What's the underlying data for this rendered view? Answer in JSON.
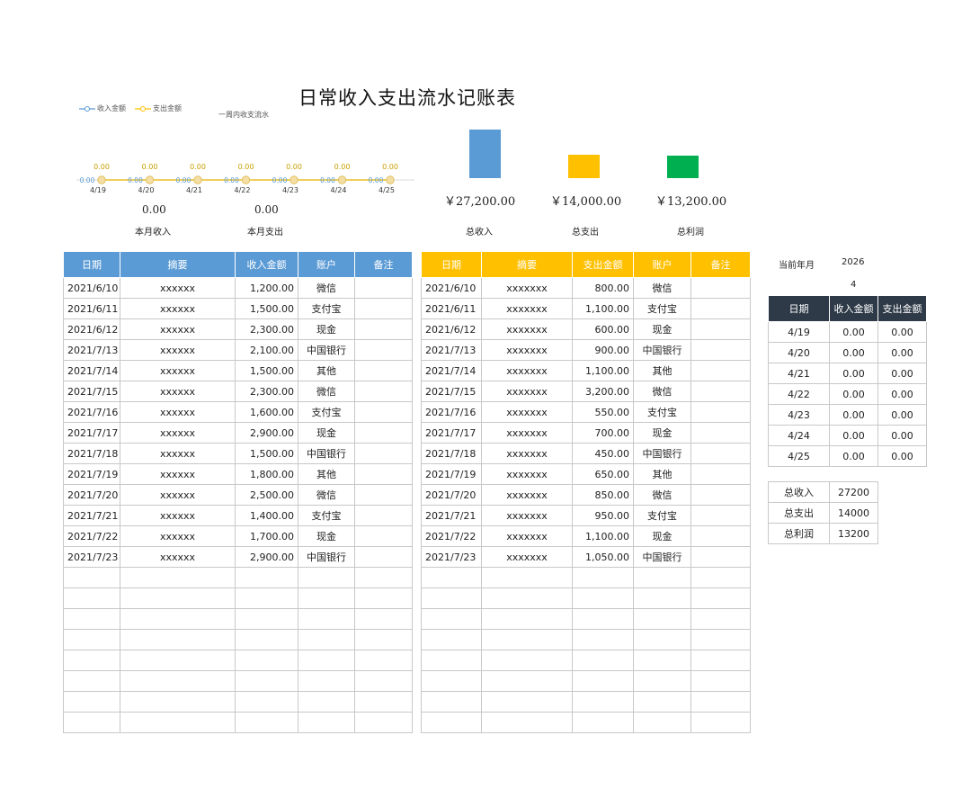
{
  "title": "日常收入支出流水记账表",
  "mini_chart": {
    "legend_income": "收入金额",
    "legend_expense": "支出金额",
    "title": "一周内收支流水"
  },
  "colors": {
    "income": "#5b9bd5",
    "expense": "#ffc000",
    "profit": "#00b050",
    "dark_header": "#2f3a48"
  },
  "month": {
    "income_value": "0.00",
    "income_label": "本月收入",
    "expense_value": "0.00",
    "expense_label": "本月支出"
  },
  "totals_display": {
    "income_value": "￥27,200.00",
    "income_label": "总收入",
    "expense_value": "￥14,000.00",
    "expense_label": "总支出",
    "profit_value": "￥13,200.00",
    "profit_label": "总利润"
  },
  "chart_data": [
    {
      "type": "line",
      "x": [
        "4/19",
        "4/20",
        "4/21",
        "4/22",
        "4/23",
        "4/24",
        "4/25"
      ],
      "series": [
        {
          "name": "收入金额",
          "values": [
            0,
            0,
            0,
            0,
            0,
            0,
            0
          ],
          "labels": [
            "0.00",
            "0.00",
            "0.00",
            "0.00",
            "0.00",
            "0.00",
            "0.00"
          ]
        },
        {
          "name": "支出金额",
          "values": [
            0,
            0,
            0,
            0,
            0,
            0,
            0
          ],
          "labels": [
            "0.00",
            "0.00",
            "0.00",
            "0.00",
            "0.00",
            "0.00",
            "0.00"
          ]
        }
      ]
    },
    {
      "type": "bar",
      "categories": [
        "总收入",
        "总支出",
        "总利润"
      ],
      "values": [
        27200,
        14000,
        13200
      ]
    }
  ],
  "income_table": {
    "headers": [
      "日期",
      "摘要",
      "收入金额",
      "账户",
      "备注"
    ],
    "rows": [
      [
        "2021/6/10",
        "xxxxxx",
        "1,200.00",
        "微信",
        ""
      ],
      [
        "2021/6/11",
        "xxxxxx",
        "1,500.00",
        "支付宝",
        ""
      ],
      [
        "2021/6/12",
        "xxxxxx",
        "2,300.00",
        "现金",
        ""
      ],
      [
        "2021/7/13",
        "xxxxxx",
        "2,100.00",
        "中国银行",
        ""
      ],
      [
        "2021/7/14",
        "xxxxxx",
        "1,500.00",
        "其他",
        ""
      ],
      [
        "2021/7/15",
        "xxxxxx",
        "2,300.00",
        "微信",
        ""
      ],
      [
        "2021/7/16",
        "xxxxxx",
        "1,600.00",
        "支付宝",
        ""
      ],
      [
        "2021/7/17",
        "xxxxxx",
        "2,900.00",
        "现金",
        ""
      ],
      [
        "2021/7/18",
        "xxxxxx",
        "1,500.00",
        "中国银行",
        ""
      ],
      [
        "2021/7/19",
        "xxxxxx",
        "1,800.00",
        "其他",
        ""
      ],
      [
        "2021/7/20",
        "xxxxxx",
        "2,500.00",
        "微信",
        ""
      ],
      [
        "2021/7/21",
        "xxxxxx",
        "1,400.00",
        "支付宝",
        ""
      ],
      [
        "2021/7/22",
        "xxxxxx",
        "1,700.00",
        "现金",
        ""
      ],
      [
        "2021/7/23",
        "xxxxxx",
        "2,900.00",
        "中国银行",
        ""
      ]
    ]
  },
  "expense_table": {
    "headers": [
      "日期",
      "摘要",
      "支出金额",
      "账户",
      "备注"
    ],
    "rows": [
      [
        "2021/6/10",
        "xxxxxxx",
        "800.00",
        "微信",
        ""
      ],
      [
        "2021/6/11",
        "xxxxxxx",
        "1,100.00",
        "支付宝",
        ""
      ],
      [
        "2021/6/12",
        "xxxxxxx",
        "600.00",
        "现金",
        ""
      ],
      [
        "2021/7/13",
        "xxxxxxx",
        "900.00",
        "中国银行",
        ""
      ],
      [
        "2021/7/14",
        "xxxxxxx",
        "1,100.00",
        "其他",
        ""
      ],
      [
        "2021/7/15",
        "xxxxxxx",
        "3,200.00",
        "微信",
        ""
      ],
      [
        "2021/7/16",
        "xxxxxxx",
        "550.00",
        "支付宝",
        ""
      ],
      [
        "2021/7/17",
        "xxxxxxx",
        "700.00",
        "现金",
        ""
      ],
      [
        "2021/7/18",
        "xxxxxxx",
        "450.00",
        "中国银行",
        ""
      ],
      [
        "2021/7/19",
        "xxxxxxx",
        "650.00",
        "其他",
        ""
      ],
      [
        "2021/7/20",
        "xxxxxxx",
        "850.00",
        "微信",
        ""
      ],
      [
        "2021/7/21",
        "xxxxxxx",
        "950.00",
        "支付宝",
        ""
      ],
      [
        "2021/7/22",
        "xxxxxxx",
        "1,100.00",
        "现金",
        ""
      ],
      [
        "2021/7/23",
        "xxxxxxx",
        "1,050.00",
        "中国银行",
        ""
      ]
    ]
  },
  "current_period": {
    "label": "当前年月",
    "year": "2026",
    "month": "4"
  },
  "weekly_table": {
    "headers": [
      "日期",
      "收入金额",
      "支出金额"
    ],
    "rows": [
      [
        "4/19",
        "0.00",
        "0.00"
      ],
      [
        "4/20",
        "0.00",
        "0.00"
      ],
      [
        "4/21",
        "0.00",
        "0.00"
      ],
      [
        "4/22",
        "0.00",
        "0.00"
      ],
      [
        "4/23",
        "0.00",
        "0.00"
      ],
      [
        "4/24",
        "0.00",
        "0.00"
      ],
      [
        "4/25",
        "0.00",
        "0.00"
      ]
    ]
  },
  "summary_table": {
    "rows": [
      [
        "总收入",
        "27200"
      ],
      [
        "总支出",
        "14000"
      ],
      [
        "总利润",
        "13200"
      ]
    ]
  }
}
